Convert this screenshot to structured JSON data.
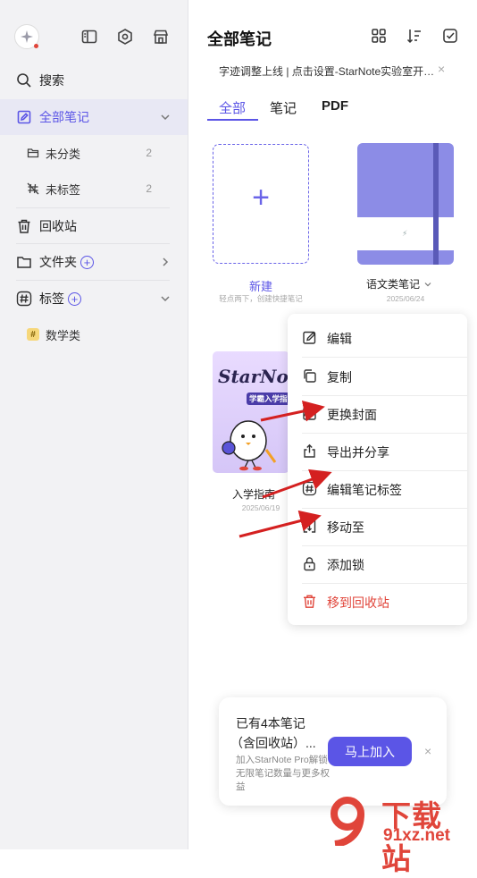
{
  "sidebar": {
    "top_icons": [
      "app-logo-icon",
      "sidebar-toggle-icon",
      "settings-hex-icon",
      "store-icon"
    ],
    "search_label": "搜索",
    "all_notes_label": "全部笔记",
    "uncategorized_label": "未分类",
    "uncategorized_count": "2",
    "untagged_label": "未标签",
    "untagged_count": "2",
    "trash_label": "回收站",
    "folder_label": "文件夹",
    "tags_label": "标签",
    "tag_item_label": "数学类"
  },
  "header": {
    "title": "全部笔记",
    "icons": [
      "grid-view-icon",
      "sort-icon",
      "select-check-icon"
    ],
    "announcement": "字迹调整上线 | 点击设置-StarNote实验室开…",
    "announcement_close": "×"
  },
  "tabs": [
    {
      "label": "全部",
      "active": true
    },
    {
      "label": "笔记",
      "active": false
    },
    {
      "label": "PDF",
      "active": false
    }
  ],
  "notes": {
    "new_card": {
      "plus": "+",
      "label": "新建",
      "hint": "轻点两下，创建快捷笔记"
    },
    "notebook": {
      "label": "语文类笔记",
      "date": "2025/06/24",
      "cover_color": "#8c8ce6"
    },
    "guide": {
      "label": "入学指南",
      "date": "2025/06/19",
      "cover_title": "StarNote",
      "cover_subtitle": "学霸入学指南"
    }
  },
  "context_menu": {
    "items": [
      {
        "label": "编辑",
        "icon": "edit-icon"
      },
      {
        "label": "复制",
        "icon": "copy-icon"
      },
      {
        "label": "更换封面",
        "icon": "change-cover-icon"
      },
      {
        "label": "导出并分享",
        "icon": "share-icon"
      },
      {
        "label": "编辑笔记标签",
        "icon": "hash-tag-icon"
      },
      {
        "label": "移动至",
        "icon": "move-icon"
      },
      {
        "label": "添加锁",
        "icon": "lock-icon"
      },
      {
        "label": "移到回收站",
        "icon": "trash-icon",
        "danger": true
      }
    ]
  },
  "promo": {
    "title_line1": "已有4本笔记",
    "title_line2": "（含回收站）...",
    "desc": "加入StarNote Pro解锁无限笔记数量与更多权益",
    "button_label": "马上加入",
    "close": "×"
  },
  "watermark": {
    "text": "下载站",
    "url_text": "91xz.net"
  },
  "colors": {
    "accent": "#5b55e6",
    "danger": "#e0453a",
    "arrow": "#d42020"
  }
}
